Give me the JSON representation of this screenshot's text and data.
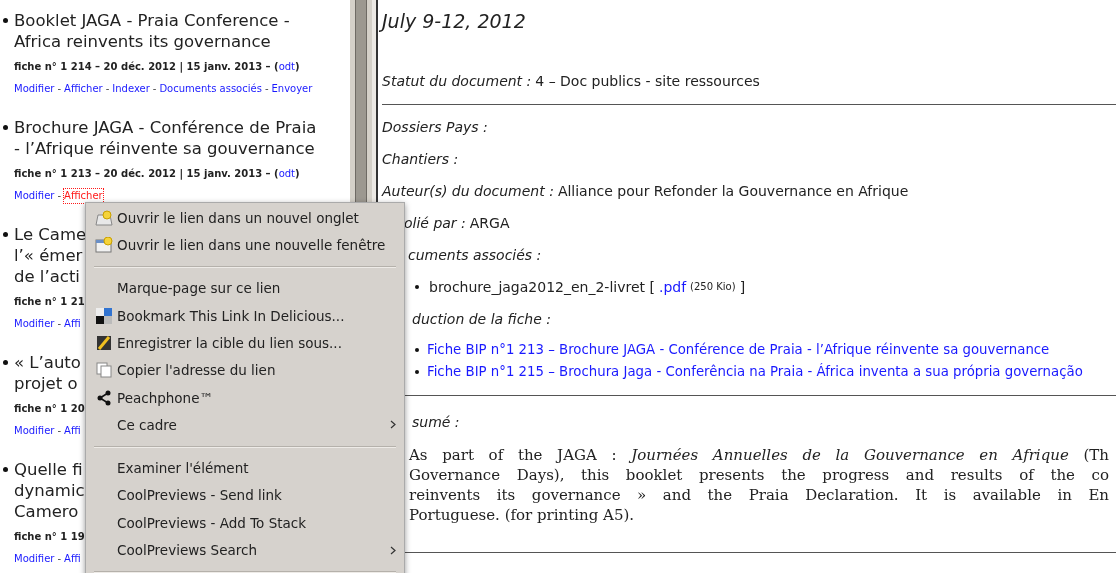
{
  "left_list": [
    {
      "title_lines": [
        "Booklet JAGA - Praia Conference -",
        "Africa reinvents its governance"
      ],
      "meta": "fiche n° 1 214 – 20 déc. 2012 | 15 janv. 2013 – (",
      "meta_link": "odt",
      "meta_end": ")",
      "links": [
        {
          "kind": "link",
          "label": "Modifier",
          "focused": false
        },
        {
          "kind": "separator",
          "label": "-"
        },
        {
          "kind": "link",
          "label": "Afficher",
          "focused": false
        },
        {
          "kind": "separator",
          "label": "-"
        },
        {
          "kind": "link",
          "label": "Indexer",
          "focused": false
        },
        {
          "kind": "separator",
          "label": "-"
        },
        {
          "kind": "link",
          "label": "Documents associés",
          "focused": false
        },
        {
          "kind": "separator",
          "label": "-"
        },
        {
          "kind": "link",
          "label": "Envoyer",
          "focused": false
        }
      ]
    },
    {
      "title_lines": [
        "Brochure JAGA - Conférence de Praia",
        "- l’Afrique réinvente sa gouvernance"
      ],
      "meta": "fiche n° 1 213 – 20 déc. 2012 | 15 janv. 2013 – (",
      "meta_link": "odt",
      "meta_end": ")",
      "links": [
        {
          "kind": "link",
          "label": "Modifier",
          "focused": false
        },
        {
          "kind": "separator",
          "label": "-"
        },
        {
          "kind": "link",
          "label": "Afficher",
          "focused": true
        }
      ]
    },
    {
      "title_lines": [
        "Le Came",
        "l’« émer",
        "de l’acti"
      ],
      "meta": "fiche n° 1 21",
      "links": [
        {
          "kind": "link",
          "label": "Modifier",
          "focused": false
        },
        {
          "kind": "separator",
          "label": "-"
        },
        {
          "kind": "link",
          "label": "Affi",
          "focused": false
        }
      ]
    },
    {
      "title_lines": [
        "« L’auto",
        "projet o"
      ],
      "meta": "fiche n° 1 20",
      "links": [
        {
          "kind": "link",
          "label": "Modifier",
          "focused": false
        },
        {
          "kind": "separator",
          "label": "-"
        },
        {
          "kind": "link",
          "label": "Affi",
          "focused": false
        }
      ]
    },
    {
      "title_lines": [
        "Quelle fi",
        "dynamic",
        "Camero"
      ],
      "meta": "fiche n° 1 19",
      "links": [
        {
          "kind": "link",
          "label": "Modifier",
          "focused": false
        },
        {
          "kind": "separator",
          "label": "-"
        },
        {
          "kind": "link",
          "label": "Affi",
          "focused": false
        }
      ]
    }
  ],
  "detail": {
    "date": "July 9-12, 2012",
    "status": {
      "label": "Statut du document :",
      "value": "4 – Doc publics - site ressources"
    },
    "fields": [
      {
        "label": "Dossiers Pays :",
        "clipped": false
      },
      {
        "label": "Chantiers :",
        "clipped": false
      },
      {
        "label": "Auteur(s) du document :",
        "value": "Alliance pour Refonder la Gouvernance en Afrique",
        "clipped": false
      },
      {
        "label": "olié par :",
        "value": "ARGA",
        "clipped": true
      }
    ],
    "documents": {
      "label": "cuments associés :",
      "items": [
        {
          "name": "brochure_jaga2012_en_2-livret [",
          "link": ".pdf",
          "size": "(250 Kio)",
          "end": "]"
        }
      ]
    },
    "translations": {
      "label": "duction de la fiche :",
      "links": [
        "Fiche BIP n°1 213 – Brochure JAGA - Conférence de Praia - l’Afrique réinvente sa gouvernance",
        "Fiche BIP n°1 215 – Brochura Jaga - Conferência na Praia - África inventa a sua própria governação"
      ]
    },
    "summary": {
      "label": "sumé :",
      "lines": [
        "As part of the JAGA : *Journées Annuelles de la Gouvernance en Afrique* (Th",
        "Governance Days), this booklet presents the progress and results of the co",
        "reinvents its governance » and the Praia Declaration. It is available in En",
        "Portuguese. (for printing A5)."
      ]
    }
  },
  "context_menu": [
    {
      "kind": "item",
      "label": "Ouvrir le lien dans un nouvel onglet"
    },
    {
      "kind": "item",
      "label": "Ouvrir le lien dans une nouvelle fenêtre"
    },
    {
      "kind": "separator"
    },
    {
      "kind": "item",
      "label": "Marque-page sur ce lien"
    },
    {
      "kind": "item",
      "label": "Bookmark This Link In Delicious..."
    },
    {
      "kind": "item",
      "label": "Enregistrer la cible du lien sous..."
    },
    {
      "kind": "item",
      "label": "Copier l'adresse du lien"
    },
    {
      "kind": "item",
      "label": "Peachphone™"
    },
    {
      "kind": "submenu",
      "label": "Ce cadre"
    },
    {
      "kind": "separator"
    },
    {
      "kind": "item",
      "label": "Examiner l'élément"
    },
    {
      "kind": "item",
      "label": "CoolPreviews - Send link"
    },
    {
      "kind": "item",
      "label": "CoolPreviews - Add To Stack"
    },
    {
      "kind": "submenu",
      "label": "CoolPreviews Search"
    },
    {
      "kind": "separator"
    }
  ]
}
